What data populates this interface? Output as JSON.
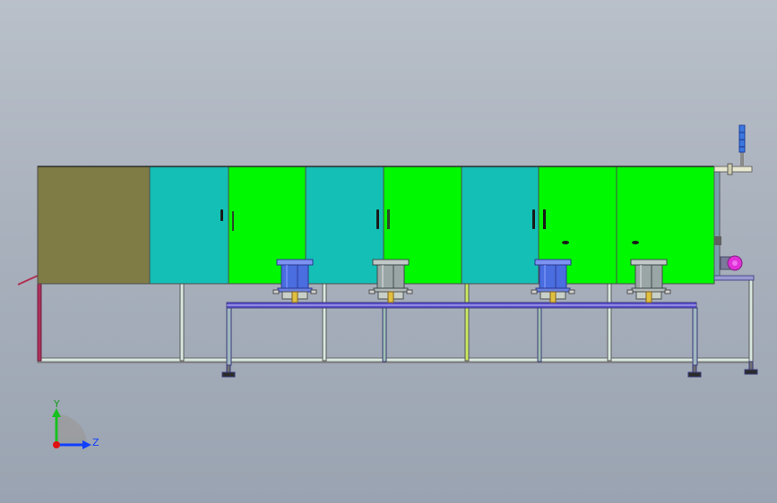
{
  "colors": {
    "background_top": "#b9c0c9",
    "background_bottom": "#9aa3b1",
    "olive_panel": "#7f7c45",
    "teal_panel": "#14bfb5",
    "green_panel": "#00f800",
    "frame_outline": "#4d4d4d",
    "table_top": "#5b4fd0",
    "bowl_blue": "#4a6de0",
    "bowl_grey": "#9aa5a5",
    "motor_magenta": "#e030d8",
    "axis_y": "#18c020",
    "axis_z": "#1040ff",
    "axis_origin": "#e01010"
  },
  "panels": [
    {
      "id": "olive",
      "color": "olive"
    },
    {
      "id": "teal-1",
      "color": "teal"
    },
    {
      "id": "green-1",
      "color": "green"
    },
    {
      "id": "teal-2",
      "color": "teal"
    },
    {
      "id": "green-2",
      "color": "green"
    },
    {
      "id": "teal-3",
      "color": "teal"
    },
    {
      "id": "green-3",
      "color": "green"
    },
    {
      "id": "green-4",
      "color": "green"
    }
  ],
  "feeders": [
    {
      "id": "feeder-1",
      "color": "blue"
    },
    {
      "id": "feeder-2",
      "color": "grey"
    },
    {
      "id": "feeder-3",
      "color": "blue"
    },
    {
      "id": "feeder-4",
      "color": "grey"
    }
  ],
  "triad": {
    "y_label": "Y",
    "z_label": "Z"
  },
  "icons": {
    "triad": "coordinate-triad-icon",
    "signal_tower": "signal-tower-icon",
    "motor": "motor-icon"
  }
}
